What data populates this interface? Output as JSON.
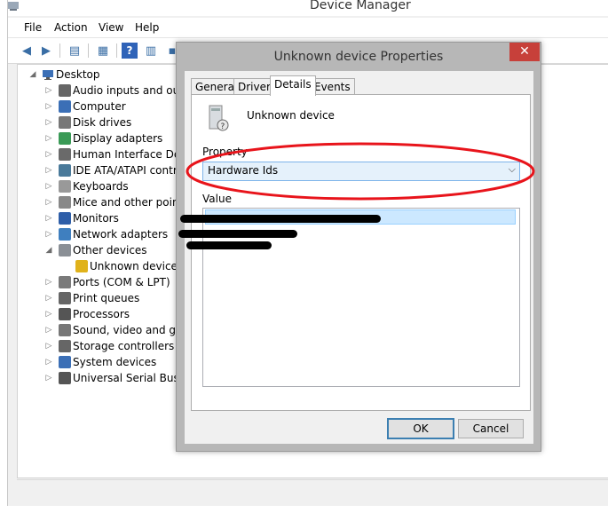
{
  "window": {
    "title": "Device Manager"
  },
  "menu": {
    "items": [
      "File",
      "Action",
      "View",
      "Help"
    ]
  },
  "tree": {
    "root": "Desktop",
    "items": [
      {
        "label": "Audio inputs and outp",
        "icon": "speaker-icon"
      },
      {
        "label": "Computer",
        "icon": "computer-icon"
      },
      {
        "label": "Disk drives",
        "icon": "disk-icon"
      },
      {
        "label": "Display adapters",
        "icon": "display-icon"
      },
      {
        "label": "Human Interface Devic",
        "icon": "hid-icon"
      },
      {
        "label": "IDE ATA/ATAPI contro",
        "icon": "ide-icon"
      },
      {
        "label": "Keyboards",
        "icon": "keyboard-icon"
      },
      {
        "label": "Mice and other pointin",
        "icon": "mouse-icon"
      },
      {
        "label": "Monitors",
        "icon": "monitor-icon"
      },
      {
        "label": "Network adapters",
        "icon": "network-icon"
      },
      {
        "label": "Other devices",
        "icon": "other-devices-icon",
        "expanded": true
      },
      {
        "label": "Unknown device",
        "icon": "unknown-device-warning-icon",
        "child": true
      },
      {
        "label": "Ports (COM & LPT)",
        "icon": "port-icon"
      },
      {
        "label": "Print queues",
        "icon": "printer-icon"
      },
      {
        "label": "Processors",
        "icon": "processor-icon"
      },
      {
        "label": "Sound, video and gam",
        "icon": "sound-icon"
      },
      {
        "label": "Storage controllers",
        "icon": "storage-icon"
      },
      {
        "label": "System devices",
        "icon": "system-icon"
      },
      {
        "label": "Universal Serial Bus co",
        "icon": "usb-icon"
      }
    ]
  },
  "dialog": {
    "title": "Unknown device Properties",
    "close": "✕",
    "tabs": [
      "General",
      "Driver",
      "Details",
      "Events"
    ],
    "active_tab": "Details",
    "device_name": "Unknown device",
    "property_label": "Property",
    "property_value": "Hardware Ids",
    "value_label": "Value",
    "ok_label": "OK",
    "cancel_label": "Cancel",
    "highlight_color": "#e8141b"
  }
}
